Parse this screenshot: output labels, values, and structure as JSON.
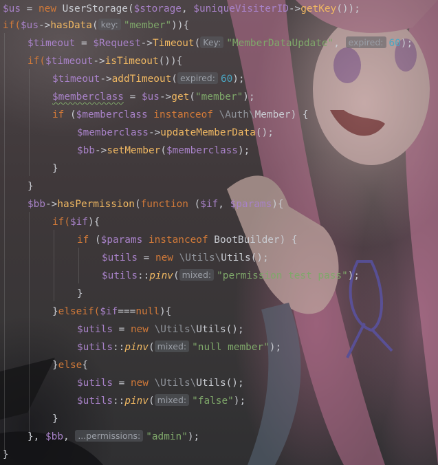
{
  "code": {
    "l1": {
      "v_us": "$us",
      "eq": " = ",
      "k_new": "new",
      "cls": " UserStorage(",
      "v_storage": "$storage",
      "comma": ", ",
      "v_uid": "$uniqueVisiterID",
      "arrow": "->",
      "fn_getkey": "getKey",
      "end": "());"
    },
    "l2": {
      "k_if": "if(",
      "v_us": "$us",
      "arrow": "->",
      "fn": "hasData",
      "open": "(",
      "hint": "key:",
      "str": "\"member\"",
      "end": ")){"
    },
    "l3": {
      "v_timeout": "$timeout",
      "eq": " = ",
      "v_req": "$Request",
      "arrow": "->",
      "fn": "Timeout",
      "open": "(",
      "hint1": "Key:",
      "str": "\"MemberDataUpdate\"",
      "comma": ", ",
      "hint2": "expired:",
      "num": "60",
      "end": ");"
    },
    "l4": {
      "k_if": "if(",
      "v_timeout": "$timeout",
      "arrow": "->",
      "fn": "isTimeout",
      "end": "()){"
    },
    "l5": {
      "v_timeout": "$timeout",
      "arrow": "->",
      "fn": "addTimeout",
      "open": "(",
      "hint": "expired:",
      "num": "60",
      "end": ");"
    },
    "l6": {
      "v_mc": "$memberclass",
      "eq": " = ",
      "v_us": "$us",
      "arrow": "->",
      "fn": "get",
      "open": "(",
      "str": "\"member\"",
      "end": ");"
    },
    "l7": {
      "k_if": "if",
      "open": " (",
      "v_mc": "$memberclass",
      "k_inst": " instanceof ",
      "ns": "\\Auth\\",
      "cls": "Member",
      "end": ") {"
    },
    "l8": {
      "v_mc": "$memberclass",
      "arrow": "->",
      "fn": "updateMemberData",
      "end": "();"
    },
    "l9": {
      "v_bb": "$bb",
      "arrow": "->",
      "fn": "setMember",
      "open": "(",
      "v_mc": "$memberclass",
      "end": ");"
    },
    "l10": {
      "text": "}"
    },
    "l11": {
      "text": "}"
    },
    "l12": {
      "v_bb": "$bb",
      "arrow": "->",
      "fn": "hasPermission",
      "open": "(",
      "k_function": "function",
      "sp": " (",
      "v_if": "$if",
      "comma": ", ",
      "v_params": "$params",
      "end": "){"
    },
    "l13": {
      "k_if": "if(",
      "v_if": "$if",
      "end": "){"
    },
    "l14": {
      "k_if": "if",
      "open": " (",
      "v_params": "$params",
      "k_inst": " instanceof ",
      "cls": "BootBuilder",
      "end": ") {"
    },
    "l15": {
      "v_utils": "$utils",
      "eq": " = ",
      "k_new": "new",
      "ns": " \\Utils\\",
      "cls": "Utils",
      "end": "();"
    },
    "l16": {
      "v_utils": "$utils",
      "dc": "::",
      "fn": "pinv",
      "open": "(",
      "hint": "mixed:",
      "str": "\"permission test pass\"",
      "end": ");"
    },
    "l17": {
      "text": "}"
    },
    "l18": {
      "close": "}",
      "k_elseif": "elseif(",
      "v_if": "$if",
      "op": "===",
      "k_null": "null",
      "end": "){"
    },
    "l19": {
      "v_utils": "$utils",
      "eq": " = ",
      "k_new": "new",
      "ns": " \\Utils\\",
      "cls": "Utils",
      "end": "();"
    },
    "l20": {
      "v_utils": "$utils",
      "dc": "::",
      "fn": "pinv",
      "open": "(",
      "hint": "mixed:",
      "str": "\"null member\"",
      "end": ");"
    },
    "l21": {
      "close": "}",
      "k_else": "else",
      "end": "{"
    },
    "l22": {
      "v_utils": "$utils",
      "eq": " = ",
      "k_new": "new",
      "ns": " \\Utils\\",
      "cls": "Utils",
      "end": "();"
    },
    "l23": {
      "v_utils": "$utils",
      "dc": "::",
      "fn": "pinv",
      "open": "(",
      "hint": "mixed:",
      "str": "\"false\"",
      "end": ");"
    },
    "l24": {
      "text": "}"
    },
    "l25": {
      "close": "}, ",
      "v_bb": "$bb",
      "comma": ", ",
      "hint": "...permissions:",
      "str": "\"admin\"",
      "end": ");"
    },
    "l26": {
      "text": "}"
    }
  },
  "colors": {
    "keyword": "#d27a39",
    "variable": "#a882c8",
    "function": "#f0b862",
    "string": "#7fa86a",
    "number": "#4aa6c2",
    "text": "#c9ccd2"
  },
  "background": {
    "image": "anime-girl-wallpaper"
  }
}
